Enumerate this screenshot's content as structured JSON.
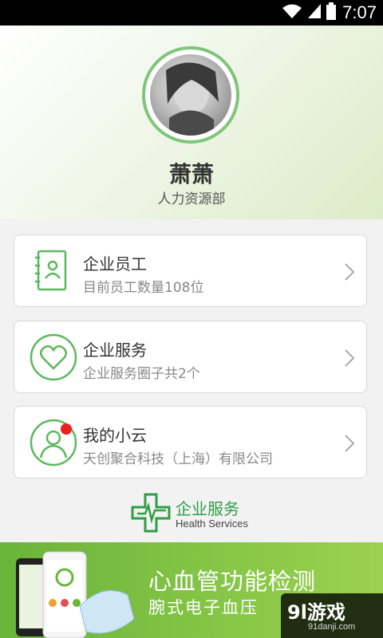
{
  "status_bar": {
    "time": "7:07",
    "icons": [
      "wifi-icon",
      "signal-icon",
      "battery-icon"
    ]
  },
  "profile": {
    "name": "萧萧",
    "department": "人力资源部"
  },
  "cards": [
    {
      "title": "企业员工",
      "subtitle": "目前员工数量108位",
      "icon": "contacts-book-icon"
    },
    {
      "title": "企业服务",
      "subtitle": "企业服务圈子共2个",
      "icon": "heart-icon"
    },
    {
      "title": "我的小云",
      "subtitle": "天创聚合科技（上海）有限公司",
      "icon": "person-icon",
      "badge": true
    }
  ],
  "brand": {
    "title": "企业服务",
    "subtitle": "Health Services"
  },
  "banner": {
    "title": "心血管功能检测",
    "subtitle": "腕式电子血压"
  },
  "watermark": {
    "brand": "9l游戏",
    "url": "91danji.com"
  },
  "colors": {
    "accent": "#7fc67a",
    "badge": "#e82020",
    "banner": "#7cc246"
  }
}
